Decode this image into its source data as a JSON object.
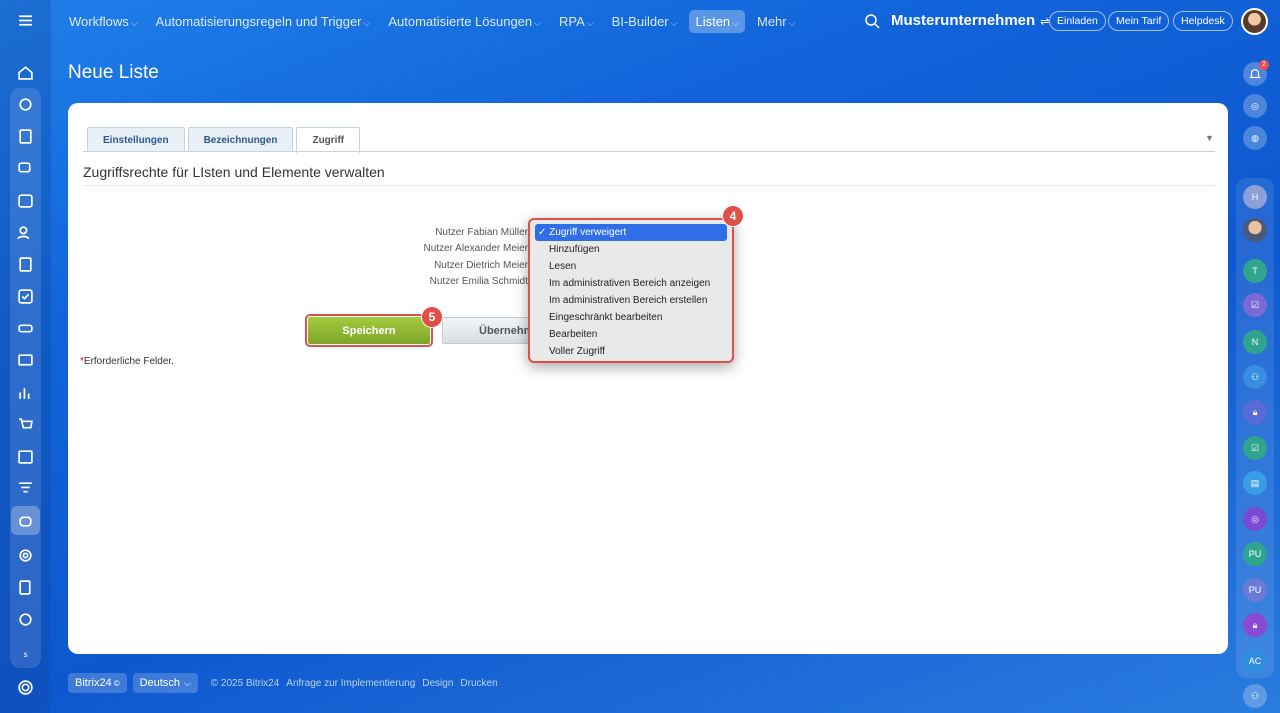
{
  "topnav": {
    "items": [
      {
        "label": "Workflows",
        "chev": "⌵"
      },
      {
        "label": "Automatisierungsregeln und Trigger",
        "chev": "⌵"
      },
      {
        "label": "Automatisierte Lösungen",
        "chev": "⌵"
      },
      {
        "label": "RPA",
        "chev": "⌵"
      },
      {
        "label": "BI-Builder",
        "chev": "⌵"
      },
      {
        "label": "Listen",
        "chev": "⌵"
      },
      {
        "label": "Mehr",
        "chev": "⌵"
      }
    ],
    "company": "Musterunternehmen",
    "invite": "Einladen",
    "plan": "Mein Tarif",
    "helpdesk": "Helpdesk"
  },
  "page": {
    "title": "Neue Liste",
    "tabs": [
      "Einstellungen",
      "Bezeichnungen",
      "Zugriff"
    ],
    "section_title": "Zugriffsrechte für LIsten und Elemente verwalten",
    "users": [
      "Nutzer Fabian Müller",
      "Nutzer Alexander Meier",
      "Nutzer Dietrich Meier",
      "Nutzer Emilia Schmidt"
    ],
    "save": "Speichern",
    "apply": "Übernehmen",
    "required_star": "*",
    "required_text": "Erforderliche Felder."
  },
  "dropdown": {
    "selected_mark": "✓",
    "options": [
      "Zugriff verweigert",
      "Hinzufügen",
      "Lesen",
      "Im administrativen Bereich anzeigen",
      "Im administrativen Bereich erstellen",
      "Eingeschränkt bearbeiten",
      "Bearbeiten",
      "Voller Zugriff"
    ]
  },
  "steps": {
    "dropdown": "4",
    "save": "5"
  },
  "notifications": {
    "count": "2"
  },
  "rightbar": {
    "initials": [
      "H",
      "T",
      "N",
      "PU",
      "PU",
      "AC"
    ]
  },
  "leftbar": {
    "small_label": "s"
  },
  "footer": {
    "brand": "Bitrix24",
    "brand_mark": "©",
    "language": "Deutsch",
    "copyright": "© 2025 Bitrix24",
    "links": [
      "Anfrage zur Implementierung",
      "Design",
      "Drucken"
    ]
  }
}
